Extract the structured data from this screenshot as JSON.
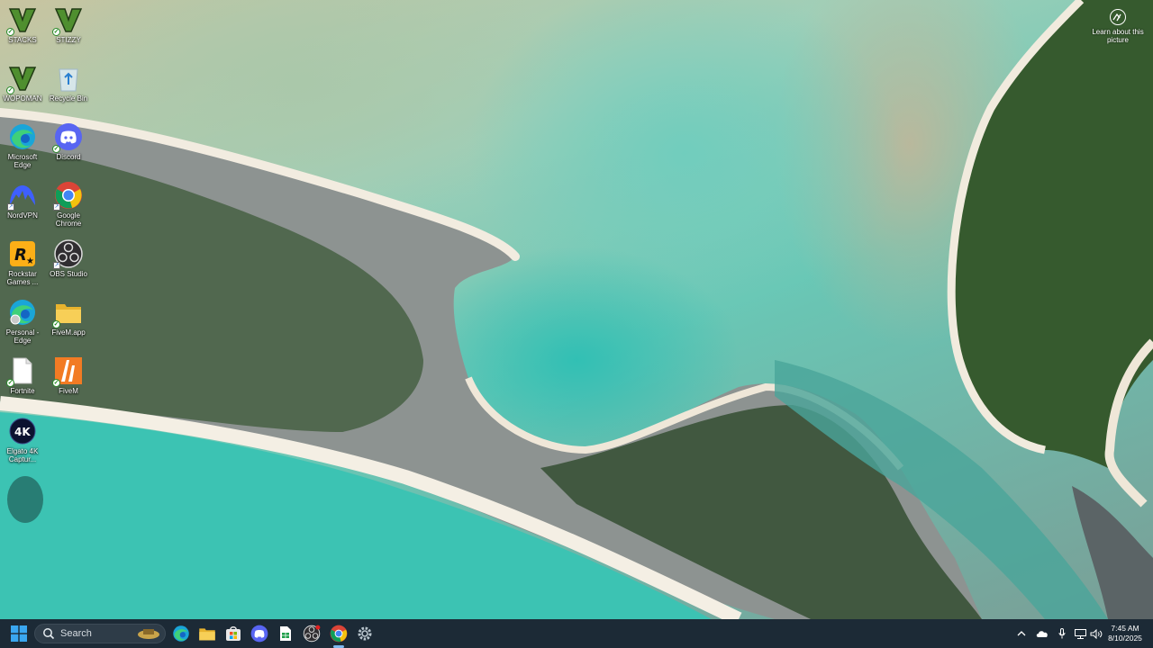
{
  "desktop": {
    "icons": [
      {
        "label": "STACKS"
      },
      {
        "label": "STIZZY"
      },
      {
        "label": "WOPOMAN"
      },
      {
        "label": "Recycle Bin"
      },
      {
        "label": "Microsoft Edge"
      },
      {
        "label": "Discord"
      },
      {
        "label": "NordVPN"
      },
      {
        "label": "Google Chrome"
      },
      {
        "label": "Rockstar Games ..."
      },
      {
        "label": "OBS Studio"
      },
      {
        "label": "Personal - Edge"
      },
      {
        "label": "FiveM.app"
      },
      {
        "label": "Fortnite"
      },
      {
        "label": "FiveM"
      },
      {
        "label": "Elgato 4K Captur..."
      }
    ],
    "learn_about": "Learn about this picture"
  },
  "taskbar": {
    "search_placeholder": "Search",
    "pinned": [
      "Start",
      "Microsoft Edge",
      "File Explorer",
      "Microsoft Store",
      "Discord",
      "Google Sheets",
      "OBS Studio",
      "Google Chrome",
      "Settings"
    ],
    "time": "7:45 AM",
    "date": "8/10/2025"
  },
  "colors": {
    "taskbar_bg": "#1c2a36",
    "accent": "#1f8fff"
  }
}
